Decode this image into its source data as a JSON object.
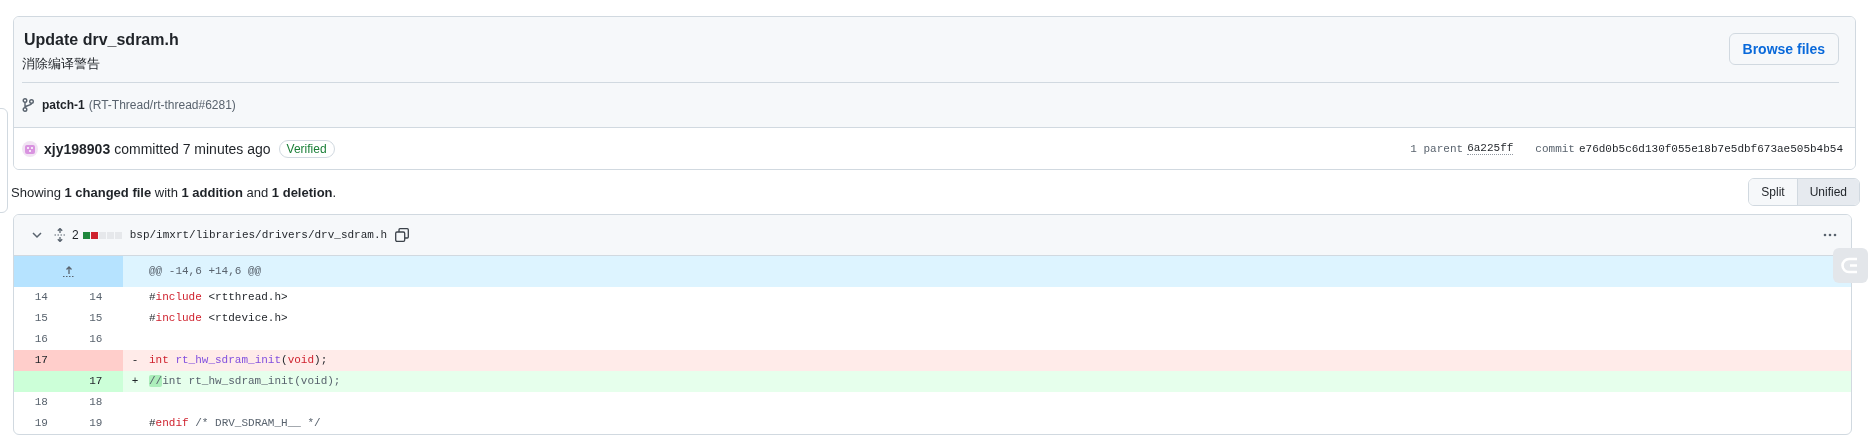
{
  "commit": {
    "title": "Update drv_sdram.h",
    "description": "消除编译警告",
    "browse_button": "Browse files",
    "branch": "patch-1",
    "pull_request": "(RT-Thread/rt-thread#6281)",
    "author": "xjy198903",
    "action": "committed 7 minutes ago",
    "verified_badge": "Verified",
    "parent_label": "1 parent",
    "parent_sha": "6a225ff",
    "commit_label": "commit",
    "commit_sha": "e76d0b5c6d130f055e18b7e5dbf673ae505b4b54"
  },
  "summary": "Showing **1 changed file** with **1 addition** and **1 deletion**.",
  "view_toggle": [
    {
      "label": "Split",
      "selected": false
    },
    {
      "label": "Unified",
      "selected": true
    }
  ],
  "file": {
    "expanded": true,
    "change_count": "2",
    "diffstat": [
      {
        "color": "#1f883d"
      },
      {
        "color": "#cf222e"
      },
      {
        "color": "#e6e8eb"
      },
      {
        "color": "#e6e8eb"
      },
      {
        "color": "#e6e8eb"
      }
    ],
    "path": "bsp/imxrt/libraries/drivers/drv_sdram.h",
    "hunk": "@@ -14,6 +14,6 @@",
    "lines": [
      {
        "kind": "context",
        "old": "14",
        "new": "14",
        "tokens": [
          {
            "text": "#",
            "kind": "plain"
          },
          {
            "text": "include",
            "kind": "keyword"
          },
          {
            "text": " <rtthread.h>",
            "kind": "plain"
          }
        ]
      },
      {
        "kind": "context",
        "old": "15",
        "new": "15",
        "tokens": [
          {
            "text": "#",
            "kind": "plain"
          },
          {
            "text": "include",
            "kind": "keyword"
          },
          {
            "text": " <rtdevice.h>",
            "kind": "plain"
          }
        ]
      },
      {
        "kind": "context",
        "old": "16",
        "new": "16"
      },
      {
        "kind": "deletion",
        "old": "17",
        "sign": "-",
        "tokens": [
          {
            "text": "int",
            "kind": "keyword"
          },
          {
            "text": " rt_hw_sdram_init",
            "kind": "function"
          },
          {
            "text": "(",
            "kind": "plain"
          },
          {
            "text": "void",
            "kind": "keyword"
          },
          {
            "text": ");",
            "kind": "plain"
          }
        ]
      },
      {
        "kind": "addition",
        "new": "17",
        "sign": "+",
        "tokens": [
          {
            "text": "//",
            "kind": "changed"
          },
          {
            "text": "int rt_hw_sdram_init(void);",
            "kind": "comment"
          }
        ]
      },
      {
        "kind": "context",
        "old": "18",
        "new": "18"
      },
      {
        "kind": "context",
        "old": "19",
        "new": "19",
        "tokens": [
          {
            "text": "#",
            "kind": "plain"
          },
          {
            "text": "endif",
            "kind": "keyword"
          },
          {
            "text": " /* DRV_SDRAM_H__ */",
            "kind": "comment"
          }
        ]
      }
    ]
  }
}
